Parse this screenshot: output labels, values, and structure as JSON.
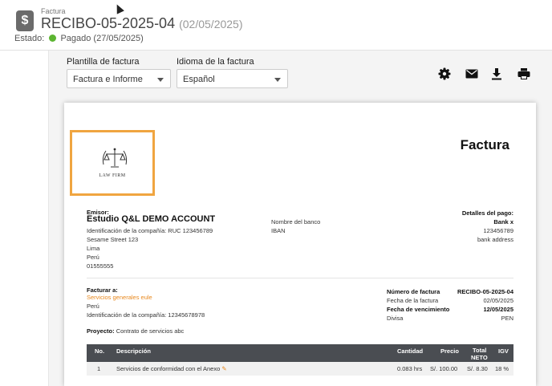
{
  "header": {
    "breadcrumb": "Factura",
    "invoice_number": "RECIBO-05-2025-04",
    "invoice_date": "(02/05/2025)",
    "status_label": "Estado:",
    "status_value": "Pagado (27/05/2025)",
    "status_color": "#5cb531"
  },
  "controls": {
    "template_label": "Plantilla de factura",
    "template_value": "Factura e Informe",
    "language_label": "Idioma de la factura",
    "language_value": "Español",
    "tools": [
      "gear-icon",
      "mail-icon",
      "download-icon",
      "print-icon"
    ]
  },
  "invoice": {
    "logo_text": "LAW FIRM",
    "doc_title": "Factura",
    "issuer_label": "Emisor:",
    "issuer_name": "Estudio Q&L DEMO ACCOUNT",
    "issuer_lines": [
      "Identificación de la compañía: RUC 123456789",
      "Sesame Street 123",
      "Lima",
      "Perú",
      "01555555"
    ],
    "bank_name_label": "Nombre del banco",
    "iban_label": "IBAN",
    "payment_title": "Detalles del pago:",
    "payment_bank": "Bank x",
    "payment_account": "123456789",
    "payment_address": "bank address",
    "bill_to_label": "Facturar a:",
    "client_name": "Servicios generales eule",
    "client_country": "Perú",
    "client_id": "Identificación de la compañía: 12345678978",
    "meta": [
      {
        "label": "Número de factura",
        "value": "RECIBO-05-2025-04"
      },
      {
        "label": "Fecha de la factura",
        "value": "02/05/2025"
      },
      {
        "label": "Fecha de vencimiento",
        "value": "12/05/2025"
      },
      {
        "label": "Divisa",
        "value": "PEN"
      }
    ],
    "project_label": "Proyecto:",
    "project_value": "Contrato de servicios abc",
    "table_headers": {
      "no": "No.",
      "desc": "Descripción",
      "qty": "Cantidad",
      "price": "Precio",
      "total1": "Total",
      "total2": "NETO",
      "igv": "IGV"
    },
    "rows": [
      {
        "no": "1",
        "desc": "Servicios de conformidad con el Anexo",
        "qty": "0.083 hrs",
        "price": "S/. 100.00",
        "total": "S/. 8.30",
        "igv": "18 %"
      }
    ]
  },
  "colors": {
    "accent": "#f0a540",
    "table_header": "#4a4d52"
  }
}
